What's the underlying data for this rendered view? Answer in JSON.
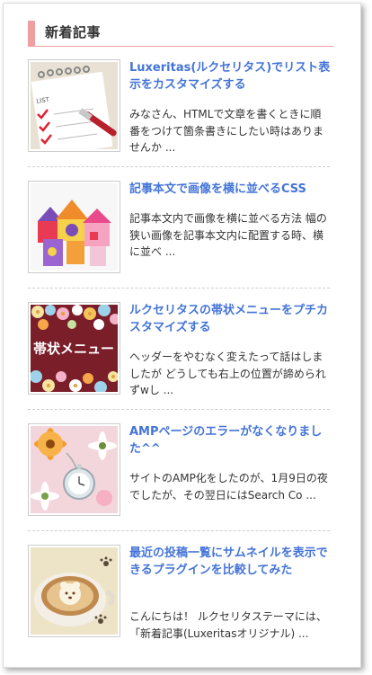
{
  "widget": {
    "title": "新着記事"
  },
  "posts": [
    {
      "title": "Luxeritas(ルクセリタス)でリスト表示をカスタマイズする",
      "excerpt": "みなさん、HTMLで文章を書くときに順番をつけて箇条書きにしたい時はありませんか ...",
      "thumb_icon": "checklist-image",
      "thumb_text": "LIST"
    },
    {
      "title": "記事本文で画像を横に並べるCSS",
      "excerpt": "記事本文内で画像を横に並べる方法 幅の狭い画像を記事本文内に配置する時、横に並べ ...",
      "thumb_icon": "colorful-houses-image"
    },
    {
      "title": "ルクセリタスの帯状メニューをプチカスタマイズする",
      "excerpt": "ヘッダーをやむなく変えたって話はしましたが どうしても右上の位置が諦められずwし ...",
      "thumb_icon": "flower-band-image",
      "thumb_text": "帯状メニュー"
    },
    {
      "title": "AMPページのエラーがなくなりました^^",
      "excerpt": "サイトのAMP化をしたのが、1月9日の夜でしたが、その翌日にはSearch Co ...",
      "thumb_icon": "pocket-watch-flowers-image"
    },
    {
      "title": "最近の投稿一覧にサムネイルを表示できるプラグインを比較してみた",
      "excerpt": "こんにちは！ ルクセリタステーマには、「新着記事(Luxeritasオリジナル) ...",
      "thumb_icon": "latte-art-image"
    }
  ],
  "colors": {
    "accent": "#f09ea0",
    "link": "#4474d8",
    "text": "#333333"
  }
}
